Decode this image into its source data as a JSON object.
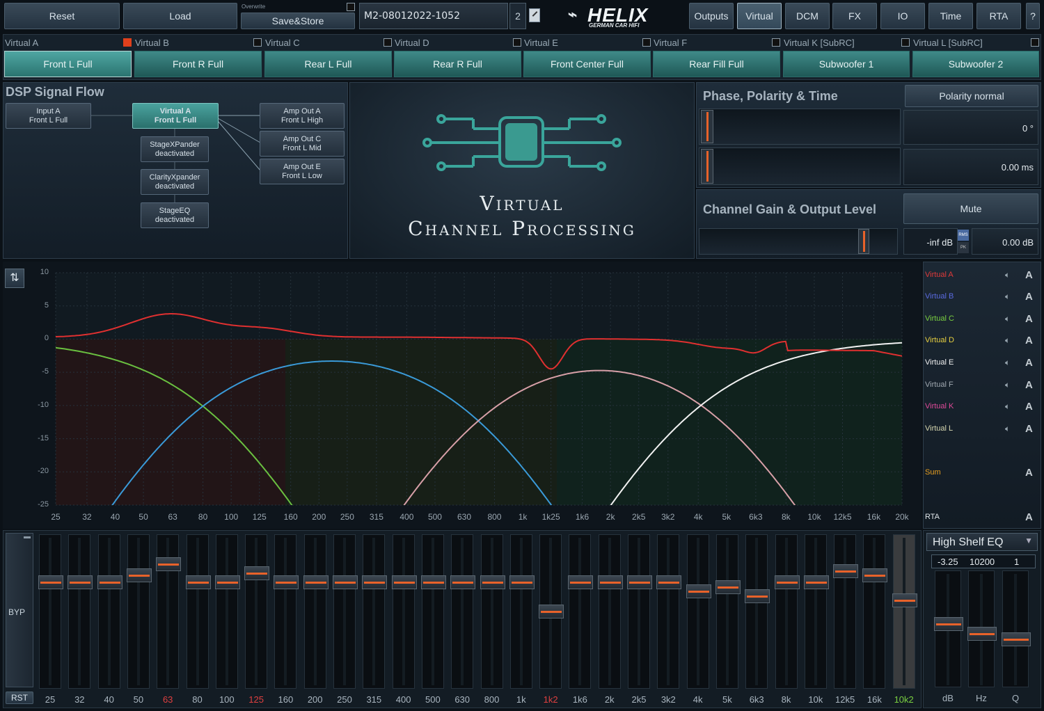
{
  "toolbar": {
    "reset": "Reset",
    "load": "Load",
    "overwrite": "Overwrite",
    "save_store": "Save&Store",
    "preset_name": "M2-08012022-1052",
    "preset_num": "2",
    "logo_main": "HELIX",
    "logo_sub": "GERMAN CAR HIFI",
    "nav": [
      "Outputs",
      "Virtual",
      "DCM",
      "FX",
      "IO",
      "Time",
      "RTA",
      "?"
    ]
  },
  "virtual_tabs": [
    {
      "label": "Virtual A",
      "channel": "Front L Full"
    },
    {
      "label": "Virtual B",
      "channel": "Front R Full"
    },
    {
      "label": "Virtual C",
      "channel": "Rear L Full"
    },
    {
      "label": "Virtual D",
      "channel": "Rear R Full"
    },
    {
      "label": "Virtual E",
      "channel": "Front Center Full"
    },
    {
      "label": "Virtual F",
      "channel": "Rear Fill Full"
    },
    {
      "label": "Virtual K [SubRC]",
      "channel": "Subwoofer 1"
    },
    {
      "label": "Virtual L [SubRC]",
      "channel": "Subwoofer 2"
    }
  ],
  "dsp": {
    "title": "DSP Signal Flow",
    "input_l1": "Input A",
    "input_l2": "Front L Full",
    "virt_l1": "Virtual A",
    "virt_l2": "Front L Full",
    "sx_l1": "StageXPander",
    "sx_l2": "deactivated",
    "cx_l1": "ClarityXpander",
    "cx_l2": "deactivated",
    "seq_l1": "StageEQ",
    "seq_l2": "deactivated",
    "outa_l1": "Amp Out A",
    "outa_l2": "Front L High",
    "outc_l1": "Amp Out C",
    "outc_l2": "Front L Mid",
    "oute_l1": "Amp Out E",
    "oute_l2": "Front L Low"
  },
  "vcp": {
    "line1": "Virtual",
    "line2": "Channel Processing"
  },
  "phase": {
    "title": "Phase, Polarity & Time",
    "polarity": "Polarity normal",
    "phase_val": "0 °",
    "time_val": "0.00 ms"
  },
  "gain": {
    "title": "Channel Gain & Output Level",
    "mute": "Mute",
    "level": "-inf dB",
    "gain_val": "0.00 dB",
    "rms": "RMS",
    "pk": "PK"
  },
  "graph": {
    "y_ticks": [
      "10",
      "5",
      "0",
      "-5",
      "-10",
      "-15",
      "-20",
      "-25"
    ],
    "x_ticks": [
      "25",
      "32",
      "40",
      "50",
      "63",
      "80",
      "100",
      "125",
      "160",
      "200",
      "250",
      "315",
      "400",
      "500",
      "630",
      "800",
      "1k",
      "1k25",
      "1k6",
      "2k",
      "2k5",
      "3k2",
      "4k",
      "5k",
      "6k3",
      "8k",
      "10k",
      "12k5",
      "16k",
      "20k"
    ]
  },
  "legend": [
    {
      "name": "Virtual A",
      "color": "#e03a3a"
    },
    {
      "name": "Virtual B",
      "color": "#5a6ae0"
    },
    {
      "name": "Virtual C",
      "color": "#7ad040"
    },
    {
      "name": "Virtual D",
      "color": "#e8d040"
    },
    {
      "name": "Virtual E",
      "color": "#f0f0f0"
    },
    {
      "name": "Virtual F",
      "color": "#a0a8b0"
    },
    {
      "name": "Virtual K",
      "color": "#e04a9a"
    },
    {
      "name": "Virtual L",
      "color": "#d8d8b0"
    },
    {
      "name": "Sum",
      "color": "#e8a020"
    },
    {
      "name": "RTA",
      "color": "#e0e6ea"
    }
  ],
  "eq": {
    "bands": [
      {
        "f": "25",
        "g": 0,
        "red": false
      },
      {
        "f": "32",
        "g": 0,
        "red": false
      },
      {
        "f": "40",
        "g": 0,
        "red": false
      },
      {
        "f": "50",
        "g": 1.5,
        "red": false
      },
      {
        "f": "63",
        "g": 4,
        "red": true
      },
      {
        "f": "80",
        "g": 0,
        "red": false
      },
      {
        "f": "100",
        "g": 0,
        "red": false
      },
      {
        "f": "125",
        "g": 2,
        "red": true
      },
      {
        "f": "160",
        "g": 0,
        "red": false
      },
      {
        "f": "200",
        "g": 0,
        "red": false
      },
      {
        "f": "250",
        "g": 0,
        "red": false
      },
      {
        "f": "315",
        "g": 0,
        "red": false
      },
      {
        "f": "400",
        "g": 0,
        "red": false
      },
      {
        "f": "500",
        "g": 0,
        "red": false
      },
      {
        "f": "630",
        "g": 0,
        "red": false
      },
      {
        "f": "800",
        "g": 0,
        "red": false
      },
      {
        "f": "1k",
        "g": 0,
        "red": false
      },
      {
        "f": "1k2",
        "g": -6.5,
        "red": true
      },
      {
        "f": "1k6",
        "g": 0,
        "red": false
      },
      {
        "f": "2k",
        "g": 0,
        "red": false
      },
      {
        "f": "2k5",
        "g": 0,
        "red": false
      },
      {
        "f": "3k2",
        "g": 0,
        "red": false
      },
      {
        "f": "4k",
        "g": -2,
        "red": false
      },
      {
        "f": "5k",
        "g": -1,
        "red": false
      },
      {
        "f": "6k3",
        "g": -3,
        "red": false
      },
      {
        "f": "8k",
        "g": 0,
        "red": false
      },
      {
        "f": "10k",
        "g": 0,
        "red": false
      },
      {
        "f": "12k5",
        "g": 2.5,
        "red": false
      },
      {
        "f": "16k",
        "g": 1.5,
        "red": false
      },
      {
        "f": "10k2",
        "g": -4,
        "red": false
      }
    ],
    "byp": "BYP",
    "rst": "RST"
  },
  "shelf": {
    "type": "High Shelf EQ",
    "db": "-3.25",
    "hz": "10200",
    "q": "1",
    "l_db": "dB",
    "l_hz": "Hz",
    "l_q": "Q"
  }
}
